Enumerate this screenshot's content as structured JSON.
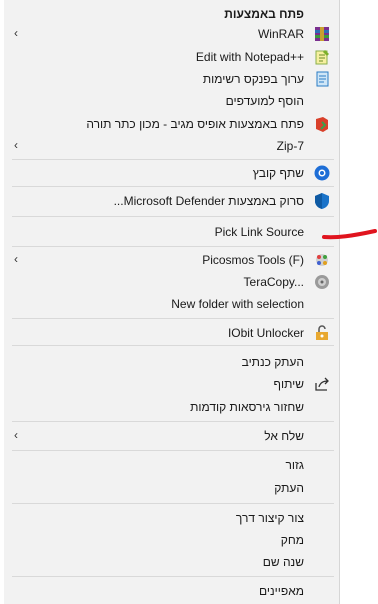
{
  "menu": {
    "open_with": "פתח באמצעות",
    "winrar": "WinRAR",
    "edit_notepad": "Edit with Notepad++",
    "edit_notepad_rtl": "‏Edit with Notepad++",
    "edit_in_notepad_he": "ערוך בפנקס רשימות",
    "add_favorites": "הוסף למועדפים",
    "open_office": "פתח באמצעות אופיס מגיב - מכון כתר תורה",
    "zip7": "Zip-7",
    "share_file": "שתף קובץ",
    "defender": "סרוק באמצעות Microsoft Defender...",
    "pick_link": "Pick Link Source",
    "picosmos": "Picosmos Tools (F)",
    "teracopy": "TeraCopy...",
    "new_folder_sel": "New folder with selection",
    "iobit": "IObit Unlocker",
    "copy_path": "העתק כנתיב",
    "share": "שיתוף",
    "restore_prev": "שחזור גירסאות קודמות",
    "send_to": "שלח אל",
    "cut": "גזור",
    "copy": "העתק",
    "create_shortcut": "צור קיצור דרך",
    "delete": "מחק",
    "rename": "שנה שם",
    "properties": "מאפיינים"
  },
  "icons": {
    "winrar": "winrar-icon",
    "notepadpp": "notepadpp-icon",
    "notepad": "notepad-icon",
    "office": "office-icon",
    "share": "share-circle-icon",
    "defender": "shield-icon",
    "picosmos": "picosmos-icon",
    "teracopy": "teracopy-icon",
    "iobit": "lock-icon",
    "share2": "share-arrow-icon",
    "submenu": "chevron-left-icon"
  },
  "colors": {
    "menu_bg": "#f2f2f2",
    "separator": "#d9d9d9",
    "red_mark": "#e0141e"
  }
}
